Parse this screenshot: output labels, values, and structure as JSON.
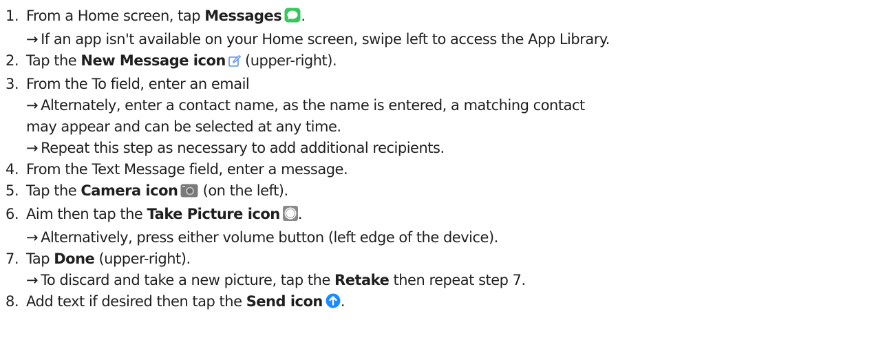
{
  "steps": [
    {
      "num": "1.",
      "pre": "From a Home screen, tap ",
      "bold": "Messages",
      "post": ".",
      "icon": "messages-app-icon",
      "notes": [
        "If an app isn't available on your Home screen, swipe left to access the App Library."
      ]
    },
    {
      "num": "2.",
      "pre": "Tap the ",
      "bold": "New Message icon",
      "post": " (upper-right).",
      "icon": "new-message-icon"
    },
    {
      "num": "3.",
      "text": "From the To field, enter an email",
      "notes": [
        "Alternately, enter a contact name, as the name is entered, a matching contact",
        "may appear and can be selected at any time.",
        "Repeat this step as necessary to add additional recipients."
      ]
    },
    {
      "num": "4.",
      "text": "From the Text Message field, enter a message."
    },
    {
      "num": "5.",
      "pre": "Tap the ",
      "bold": "Camera icon",
      "post": " (on the left).",
      "icon": "camera-icon"
    },
    {
      "num": "6.",
      "pre": "Aim then tap the ",
      "bold": "Take Picture icon",
      "post": ".",
      "icon": "take-picture-icon",
      "notes": [
        "Alternatively, press either volume button (left edge of the device)."
      ]
    },
    {
      "num": "7.",
      "pre": "Tap ",
      "bold": "Done",
      "post": " (upper-right).",
      "note_pre": "To discard and take a new picture, tap the ",
      "note_bold": "Retake",
      "note_post": " then repeat step 7."
    },
    {
      "num": "8.",
      "pre": "Add text if desired then tap the ",
      "bold": "Send icon",
      "post": ".",
      "icon": "send-icon"
    }
  ],
  "arrow": "→",
  "colors": {
    "messages_green": "#34c759",
    "compose_blue": "#3b82f6",
    "send_blue": "#1a8cff",
    "camera_gray": "#7a7a7a"
  }
}
